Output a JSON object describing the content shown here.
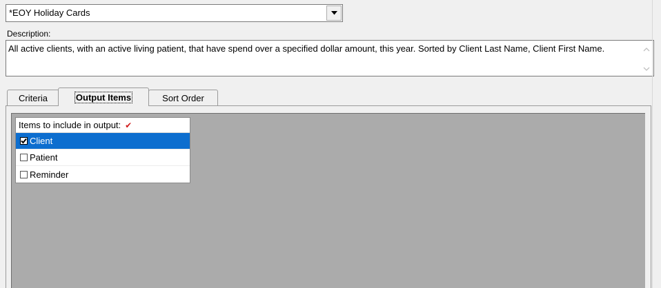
{
  "report_select": {
    "value": "*EOY Holiday Cards"
  },
  "description": {
    "label": "Description:",
    "text": "All active clients, with an active living patient, that have spend over a specified dollar amount, this year.  Sorted by Client Last Name, Client First Name."
  },
  "tabs": [
    {
      "label": "Criteria",
      "active": false
    },
    {
      "label": "Output Items",
      "active": true
    },
    {
      "label": "Sort Order",
      "active": false
    }
  ],
  "output_list": {
    "header": "Items to include in output:",
    "items": [
      {
        "label": "Client",
        "checked": true,
        "selected": true
      },
      {
        "label": "Patient",
        "checked": false,
        "selected": false
      },
      {
        "label": "Reminder",
        "checked": false,
        "selected": false
      }
    ]
  },
  "colors": {
    "selection": "#0d6ecf",
    "panel_grey": "#ababab",
    "header_check": "#d11a1a"
  }
}
